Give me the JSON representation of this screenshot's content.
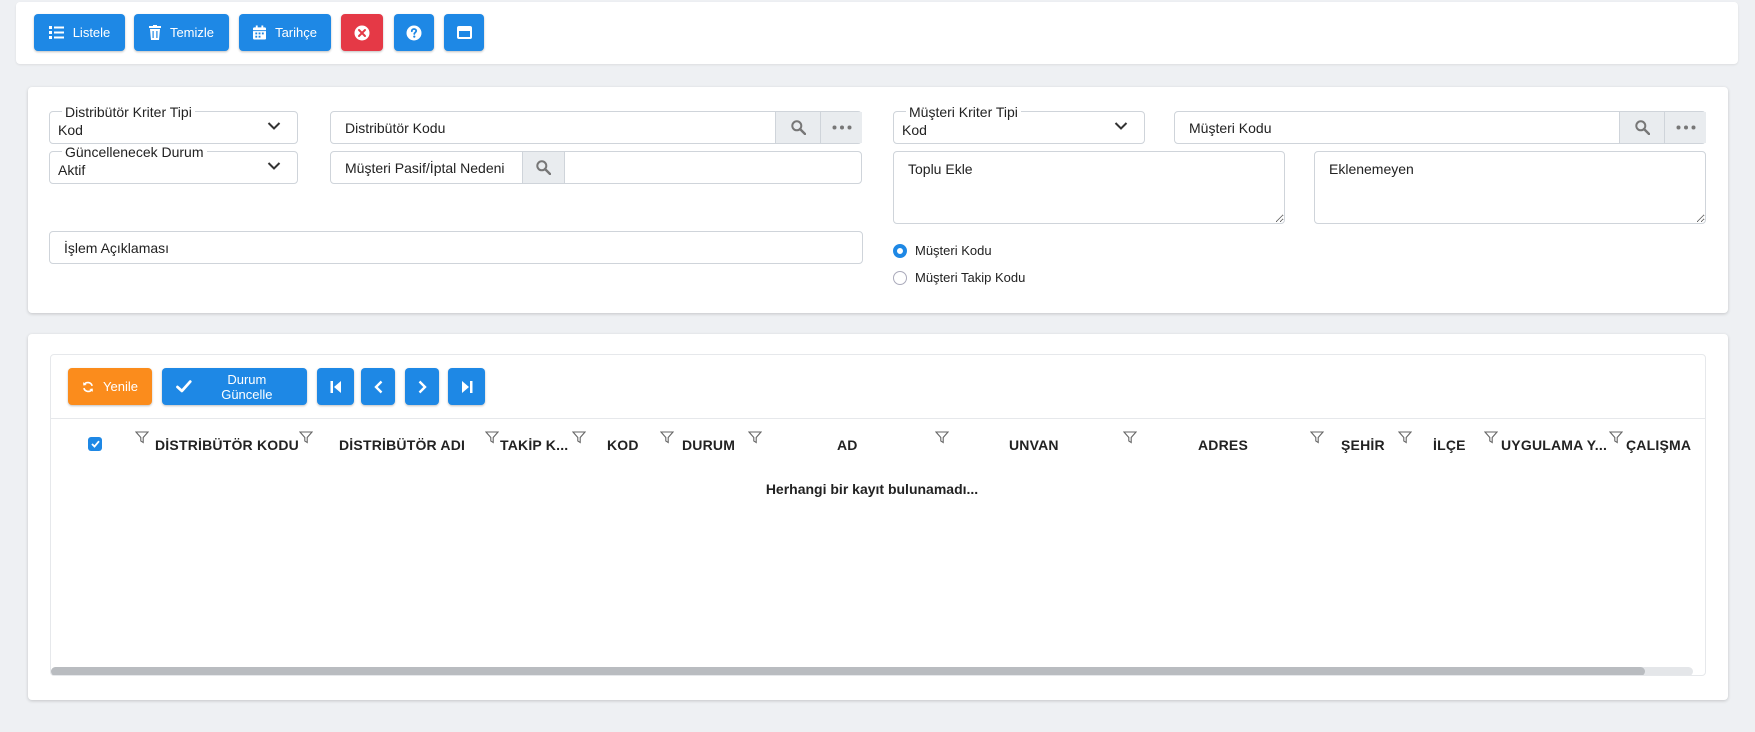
{
  "toolbar": {
    "list_label": "Listele",
    "clear_label": "Temizle",
    "history_label": "Tarihçe"
  },
  "filters": {
    "distributor_criteria": {
      "label": "Distribütör Kriter Tipi",
      "value": "Kod"
    },
    "status_to_update": {
      "label": "Güncellenecek Durum",
      "value": "Aktif"
    },
    "distributor_code": {
      "label": "Distribütör Kodu"
    },
    "passive_reason": {
      "label": "Müşteri Pasif/İptal Nedeni",
      "value": ""
    },
    "transaction_description": {
      "label": "İşlem Açıklaması"
    },
    "customer_criteria": {
      "label": "Müşteri Kriter Tipi",
      "value": "Kod"
    },
    "customer_code": {
      "label": "Müşteri Kodu"
    },
    "bulk_add": {
      "placeholder": "Toplu Ekle"
    },
    "not_added": {
      "placeholder": "Eklenemeyen"
    },
    "radio_options": [
      "Müşteri Kodu",
      "Müşteri Takip Kodu"
    ],
    "radio_selected": "Müşteri Kodu"
  },
  "grid": {
    "refresh_label": "Yenile",
    "update_status_label": "Durum Güncelle",
    "columns": [
      "DİSTRİBÜTÖR KODU",
      "DİSTRİBÜTÖR ADI",
      "TAKİP K...",
      "KOD",
      "DURUM",
      "AD",
      "UNVAN",
      "ADRES",
      "ŞEHİR",
      "İLÇE",
      "UYGULAMA Y...",
      "ÇALIŞMA"
    ],
    "empty_message": "Herhangi bir kayıt bulunamadı..."
  },
  "colors": {
    "primary": "#1e88e5",
    "danger": "#e53946",
    "warning": "#fb8c1c"
  },
  "icons": {
    "list": "list-icon",
    "clear": "trash-icon",
    "history": "calendar-icon",
    "close": "close-circle-icon",
    "help": "help-circle-icon",
    "window": "window-icon",
    "search": "search-icon",
    "more": "ellipsis-icon",
    "refresh": "refresh-icon",
    "check": "check-icon",
    "first": "first-page-icon",
    "prev": "prev-page-icon",
    "next": "next-page-icon",
    "last": "last-page-icon",
    "filter": "filter-icon"
  }
}
